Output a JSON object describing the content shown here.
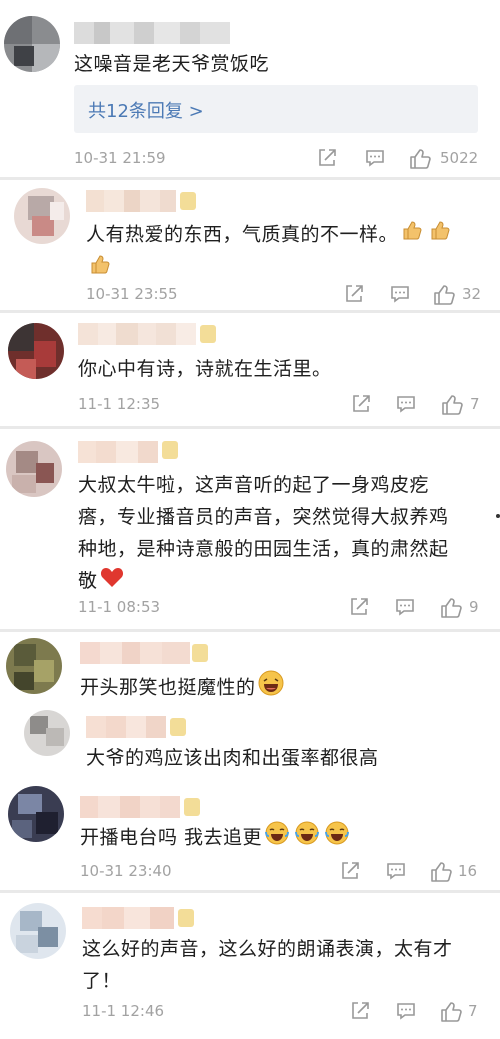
{
  "comments": [
    {
      "text": "这噪音是老天爷赏饭吃",
      "replies_label": "共12条回复 >",
      "date": "10-31 21:59",
      "likes": "5022"
    },
    {
      "text_line1": "人有热爱的东西，气质真的不一样。",
      "date": "10-31 23:55",
      "likes": "32",
      "emoji_icon": "thumbs-up"
    },
    {
      "text": "你心中有诗，诗就在生活里。",
      "date": "11-1 12:35",
      "likes": "7"
    },
    {
      "text_lines": [
        "大叔太牛啦，这声音听的起了一身鸡皮疙",
        "瘩，专业播音员的声音，突然觉得大叔养鸡",
        "种地，是种诗意般的田园生活，真的肃然起",
        "敬"
      ],
      "date": "11-1 08:53",
      "likes": "9",
      "emoji_icon": "heart"
    },
    {
      "text": "开头那笑也挺魔性的",
      "emoji_icon": "laughing-face"
    },
    {
      "text": "大爷的鸡应该出肉和出蛋率都很高"
    },
    {
      "text": "开播电台吗  我去追更",
      "date": "10-31 23:40",
      "likes": "16",
      "emoji_icon": "crying-laughing-face"
    },
    {
      "text_lines": [
        "这么好的声音，这么好的朗诵表演，太有才",
        "了！"
      ],
      "date": "11-1 12:46",
      "likes": "7"
    }
  ],
  "icons": [
    "repost-icon",
    "comment-icon",
    "like-icon"
  ],
  "colors": {
    "link": "#4c7ab5",
    "meta": "#a2a2a2",
    "reply_bg": "#f0f2f5",
    "divider": "#e9e9e9"
  }
}
